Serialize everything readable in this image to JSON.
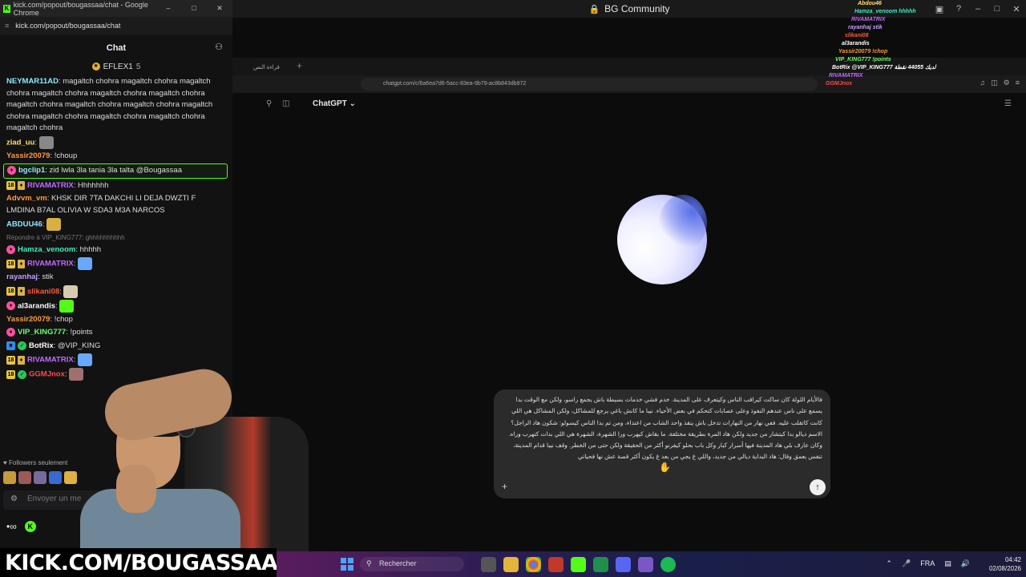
{
  "os_window": {
    "title": "BG Community"
  },
  "chat_window": {
    "title": "kick.com/popout/bougassaa/chat - Google Chrome",
    "url": "kick.com/popout/bougassaa/chat",
    "header": "Chat",
    "pinned_user": "EFLEX1",
    "pinned_count": "5",
    "messages": [
      {
        "user": "NEYMAR11AD",
        "color": "#8de8ff",
        "text": "magaltch chohra magaltch chohra magaltch chohra magaltch chohra magaltch chohra magaltch chohra magaltch chohra magaltch chohra magaltch chohra magaltch chohra magaltch chohra magaltch chohra magaltch chohra magaltch chohra"
      },
      {
        "user": "ziad_uu",
        "color": "#ffe16b",
        "text": ""
      },
      {
        "user": "Yassir20079",
        "color": "#ff9a3c",
        "text": "!choup"
      },
      {
        "user": "bgclip1",
        "color": "#8de8ff",
        "text": "zid lwla 3la tania 3la talta @Bougassaa"
      },
      {
        "user": "RIVAMATRIX",
        "color": "#c26bff",
        "text": "Hhhhhhh"
      },
      {
        "user": "Advvm_vm",
        "color": "#ff9a3c",
        "text": "KHSK DIR 7TA DAKCHI LI DEJA DWZTI F LMDINA B7AL OLIVIA W SDA3 M3A NARCOS"
      },
      {
        "user": "ABDUU46",
        "color": "#8de8ff",
        "text": ""
      },
      {
        "reply": "Répondre à VIP_KING777: ghhhhhhhhhh"
      },
      {
        "user": "Hamza_venoom",
        "color": "#3cf0c0",
        "text": "hhhhh"
      },
      {
        "user": "RIVAMATRIX",
        "color": "#c26bff",
        "text": ""
      },
      {
        "user": "rayanhaj",
        "color": "#c4a0ff",
        "text": "stik"
      },
      {
        "user": "slikani08",
        "color": "#ff5a3c",
        "text": ""
      },
      {
        "user": "al3arandis",
        "color": "#ffffff",
        "text": ""
      },
      {
        "user": "Yassir20079",
        "color": "#ff9a3c",
        "text": "!chop"
      },
      {
        "user": "VIP_KING777",
        "color": "#6bff6b",
        "text": "!points"
      },
      {
        "user": "BotRix",
        "color": "#ffffff",
        "text": "@VIP_KING"
      },
      {
        "user": "RIVAMATRIX",
        "color": "#c26bff",
        "text": ""
      },
      {
        "user": "GGMJnox",
        "color": "#ff4a4a",
        "text": ""
      }
    ],
    "followers_note": "Followers seulement",
    "input_placeholder": "Envoyer un me"
  },
  "inner_browser": {
    "tab_label": "قراءة النص",
    "url": "chatgpt.com/c/6a6ea7d6-5acc-83ea-9b79-ac8b843db872",
    "app_title": "ChatGPT",
    "message": "فالأيام اللولة كان ساكت كيراقب الناس وكيتعرف على المدينة. خدم فشي خدمات بسيطة باش يجمع راسو، ولكن مع الوقت بدا يسمع على ناس عندهم النفوذ وعلى عصابات كتحكم في بعض الأحياء. نيبا ما كانش باغي يرجع للمشاكل، ولكن المشاكل هي اللي كانت كاتقلب عليه. ففي نهار من النهارات تدخل باش ينقذ واحد الشاب من اعتداء، ومن تم بدا الناس كيسولو: شكون هاد الراجل؟ الاسم ديالو بدا كيتشار من جديد ولكن هاد المرة بطريقة مختلفة. ما بقاش كيهرب ورا الشهرة، الشهرة هي اللي بدات كتهرب وراه. وكان عارف بلي هاد المدينة فيها أسرار كبار وكل باب بحلو كيفرنو أكثر من الحقيقة ولكن حتى من الخطر. وقف نيبا قدام المدينة، تنفس بعمق وقال: هاد البداية ديالي من جديد، واللي غ يجي من بعد غ يكون أكثر قصة عش نها فحياتي"
  },
  "stream_overlay": {
    "brand": "KICK.COM/BOUGASSAA",
    "lines": [
      {
        "text": "Abdou46",
        "color": "#ffe16b"
      },
      {
        "text": "Hamza_venoom hhhhh",
        "color": "#3cf0c0"
      },
      {
        "text": "RIVAMATRIX",
        "color": "#c26bff"
      },
      {
        "text": "rayanhaj stik",
        "color": "#c4a0ff"
      },
      {
        "text": "slikani08",
        "color": "#ff5a3c"
      },
      {
        "text": "al3arandis",
        "color": "#ffffff"
      },
      {
        "text": "Yassir20079 !chop",
        "color": "#ff9a3c"
      },
      {
        "text": "VIP_KING777 !points",
        "color": "#6bff6b"
      },
      {
        "text": "BotRix @VIP_KING777 لديك 44055 نقطة",
        "color": "#ffffff"
      },
      {
        "text": "RIVAMATRIX",
        "color": "#c26bff"
      },
      {
        "text": "GGMJnox",
        "color": "#ff4a4a"
      }
    ]
  },
  "taskbar": {
    "search_label": "Rechercher",
    "lang": "FRA",
    "time": "04:42",
    "date": "02/08/2026"
  },
  "icons": [
    "search-icon",
    "lock-icon",
    "settings-icon",
    "send-arrow-icon",
    "plus-icon",
    "windows-start-icon",
    "mic-icon",
    "wifi-icon",
    "volume-icon"
  ],
  "colors": {
    "kick_green": "#53fc18",
    "chat_bg": "#121213",
    "composer_bg": "#2b2b2b"
  }
}
